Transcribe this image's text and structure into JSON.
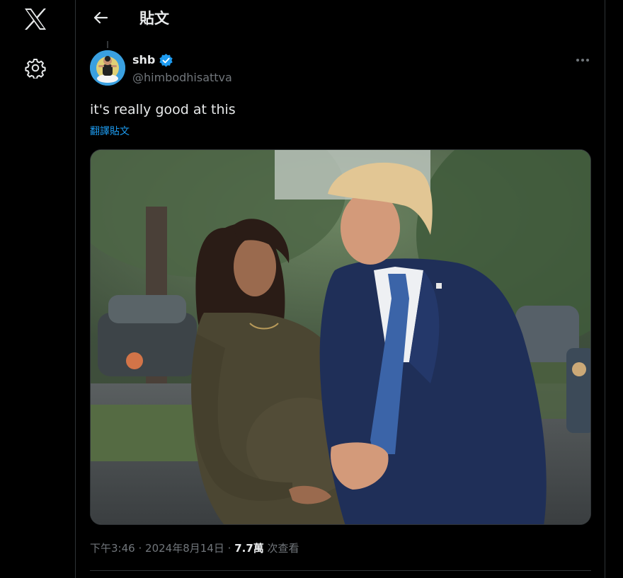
{
  "header": {
    "title": "貼文"
  },
  "tweet": {
    "author_name": "shb",
    "author_handle": "@himbodhisattva",
    "text": "it's really good at this",
    "translate_label": "翻譯貼文",
    "time": "下午3:46",
    "separator": "·",
    "date": "2024年8月14日",
    "views_count": "7.7萬",
    "views_label": "次查看"
  },
  "icons": {
    "logo": "x-logo-icon",
    "settings": "gear-icon",
    "back": "back-arrow-icon",
    "verified": "verified-badge-icon",
    "more": "more-dots-icon"
  },
  "colors": {
    "background": "#000000",
    "text_primary": "#e7e9ea",
    "text_secondary": "#71767b",
    "accent": "#1d9bf0",
    "divider": "#2f3336"
  }
}
